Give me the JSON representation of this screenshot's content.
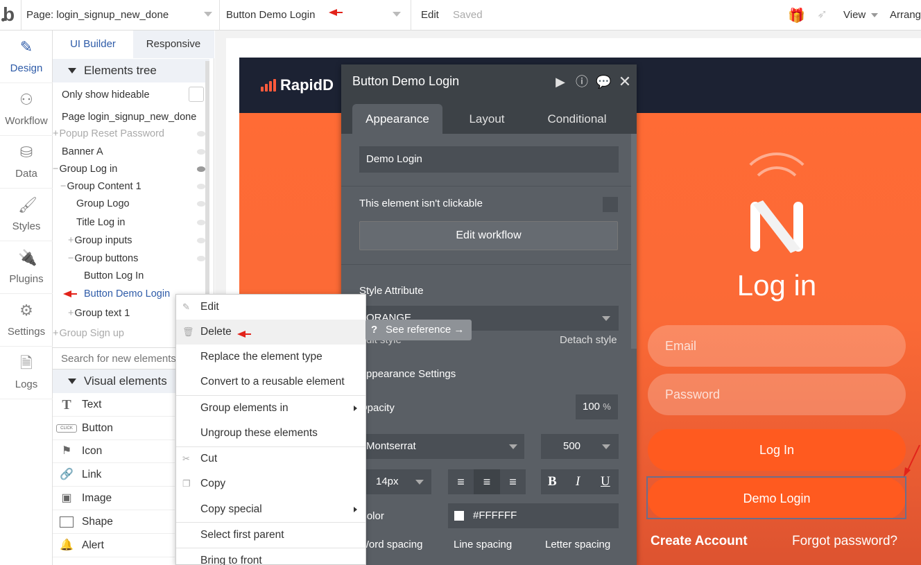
{
  "topbar": {
    "page_selector": "Page: login_signup_new_done",
    "element_selector": "Button Demo Login",
    "edit": "Edit",
    "saved": "Saved",
    "view": "View",
    "arrange": "Arrang"
  },
  "leftnav": [
    {
      "label": "Design",
      "icon": "pencil-ruler-icon"
    },
    {
      "label": "Workflow",
      "icon": "sitemap-icon"
    },
    {
      "label": "Data",
      "icon": "database-icon"
    },
    {
      "label": "Styles",
      "icon": "brush-icon"
    },
    {
      "label": "Plugins",
      "icon": "plug-icon"
    },
    {
      "label": "Settings",
      "icon": "gear-icon"
    },
    {
      "label": "Logs",
      "icon": "file-icon"
    }
  ],
  "tree_panel": {
    "tabs": [
      "UI Builder",
      "Responsive"
    ],
    "elements_tree": "Elements tree",
    "only_hideable": "Only show hideable",
    "rows": [
      "Page login_signup_new_done",
      "Popup Reset Password",
      "Banner A",
      "Group Log in",
      "Group Content 1",
      "Group Logo",
      "Title Log in",
      "Group inputs",
      "Group buttons",
      "Button Log In",
      "Button Demo Login",
      "Group text 1",
      "Group Sign up"
    ],
    "search_placeholder": "Search for new elements...",
    "visual_elements": "Visual elements",
    "visual_items": [
      "Text",
      "Button",
      "Icon",
      "Link",
      "Image",
      "Shape",
      "Alert"
    ]
  },
  "canvas": {
    "brand": "RapidD",
    "login_title": "Log in",
    "email_placeholder": "Email",
    "password_placeholder": "Password",
    "login_button": "Log In",
    "demo_button": "Demo Login",
    "create_account": "Create Account",
    "forgot_password": "Forgot password?"
  },
  "editor": {
    "title": "Button Demo Login",
    "tabs": [
      "Appearance",
      "Layout",
      "Conditional"
    ],
    "text_value": "Demo Login",
    "not_clickable": "This element isn't clickable",
    "edit_workflow": "Edit workflow",
    "style_attribute": "Style Attribute",
    "style_value": "ORANGE",
    "edit_style": "Edit style",
    "detach_style": "Detach style",
    "appearance_settings": "Appearance Settings",
    "opacity_label": "Opacity",
    "opacity_value": "100",
    "opacity_unit": "%",
    "font": "Montserrat",
    "weight": "500",
    "font_size": "14px",
    "bold": "B",
    "italic": "I",
    "underline": "U",
    "color_label": "Color",
    "color_value": "#FFFFFF",
    "word_spacing": "Word spacing",
    "line_spacing": "Line spacing",
    "letter_spacing": "Letter spacing"
  },
  "context_menu": {
    "items": [
      "Edit",
      "Delete",
      "Replace the element type",
      "Convert to a reusable element",
      "Group elements in",
      "Ungroup these elements",
      "Cut",
      "Copy",
      "Copy special",
      "Select first parent",
      "Bring to front"
    ]
  },
  "tooltip": {
    "text": "See reference →"
  },
  "colors": {
    "accent": "#2e5ba8",
    "orange": "#ff6b35",
    "editor_bg": "#5a5f65"
  }
}
